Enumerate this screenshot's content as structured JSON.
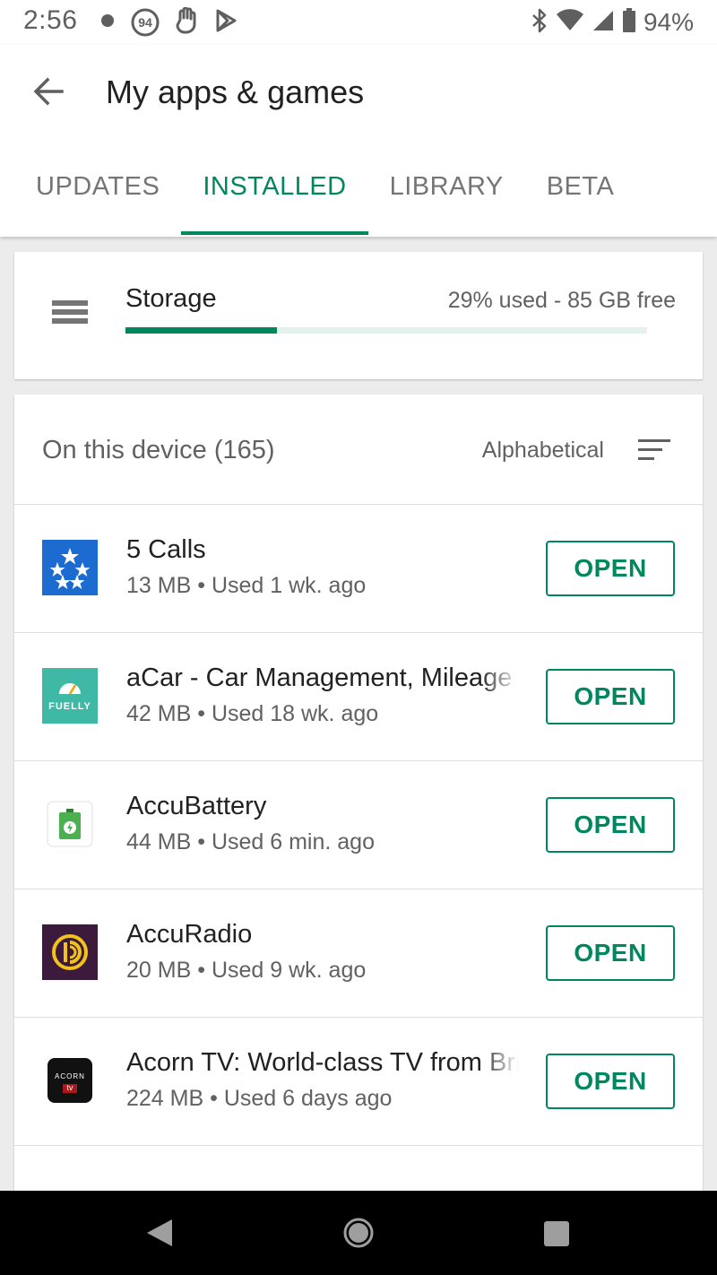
{
  "status_bar": {
    "time": "2:56",
    "left_icons": [
      "dot-icon",
      "badge-94-icon",
      "hand-icon",
      "play-store-icon"
    ],
    "badge_number": "94",
    "right_icons": [
      "bluetooth-icon",
      "wifi-icon",
      "signal-icon",
      "battery-icon"
    ],
    "battery_percent": "94%"
  },
  "header": {
    "title": "My apps & games",
    "back_icon": "arrow-back-icon"
  },
  "tabs": [
    {
      "label": "UPDATES",
      "active": false
    },
    {
      "label": "INSTALLED",
      "active": true
    },
    {
      "label": "LIBRARY",
      "active": false
    },
    {
      "label": "BETA",
      "active": false
    }
  ],
  "storage": {
    "label": "Storage",
    "stats": "29% used - 85 GB free",
    "used_fraction": 0.29
  },
  "list_header": {
    "device_count": "On this device (165)",
    "sort_label": "Alphabetical",
    "sort_icon": "sort-icon"
  },
  "apps": [
    {
      "name": "5 Calls",
      "size": "13 MB",
      "used": "Used 1 wk. ago",
      "button": "OPEN",
      "icon": "five-calls-icon"
    },
    {
      "name": "aCar - Car Management, Mileage",
      "size": "42 MB",
      "used": "Used 18 wk. ago",
      "button": "OPEN",
      "icon": "fuelly-icon",
      "icon_text": "FUELLY"
    },
    {
      "name": "AccuBattery",
      "size": "44 MB",
      "used": "Used 6 min. ago",
      "button": "OPEN",
      "icon": "accubattery-icon"
    },
    {
      "name": "AccuRadio",
      "size": "20 MB",
      "used": "Used 9 wk. ago",
      "button": "OPEN",
      "icon": "accuradio-icon"
    },
    {
      "name": "Acorn TV: World-class TV from Britain",
      "size": "224 MB",
      "used": "Used 6 days ago",
      "button": "OPEN",
      "icon": "acorn-tv-icon",
      "icon_text": "ACORN",
      "icon_subtext": "tv"
    }
  ],
  "separator": "•",
  "colors": {
    "accent": "#01875f",
    "storage_track": "#e3f2ed",
    "five_calls_blue": "#1c6bd0",
    "fuelly_teal": "#3fb8a6",
    "accubattery_green": "#4caf50",
    "accuradio_purple": "#3b1a3c",
    "accuradio_yellow": "#f2c21b",
    "acorn_red": "#a7191d"
  },
  "nav_bar": {
    "icons": [
      "nav-back-icon",
      "nav-home-icon",
      "nav-recents-icon"
    ]
  }
}
